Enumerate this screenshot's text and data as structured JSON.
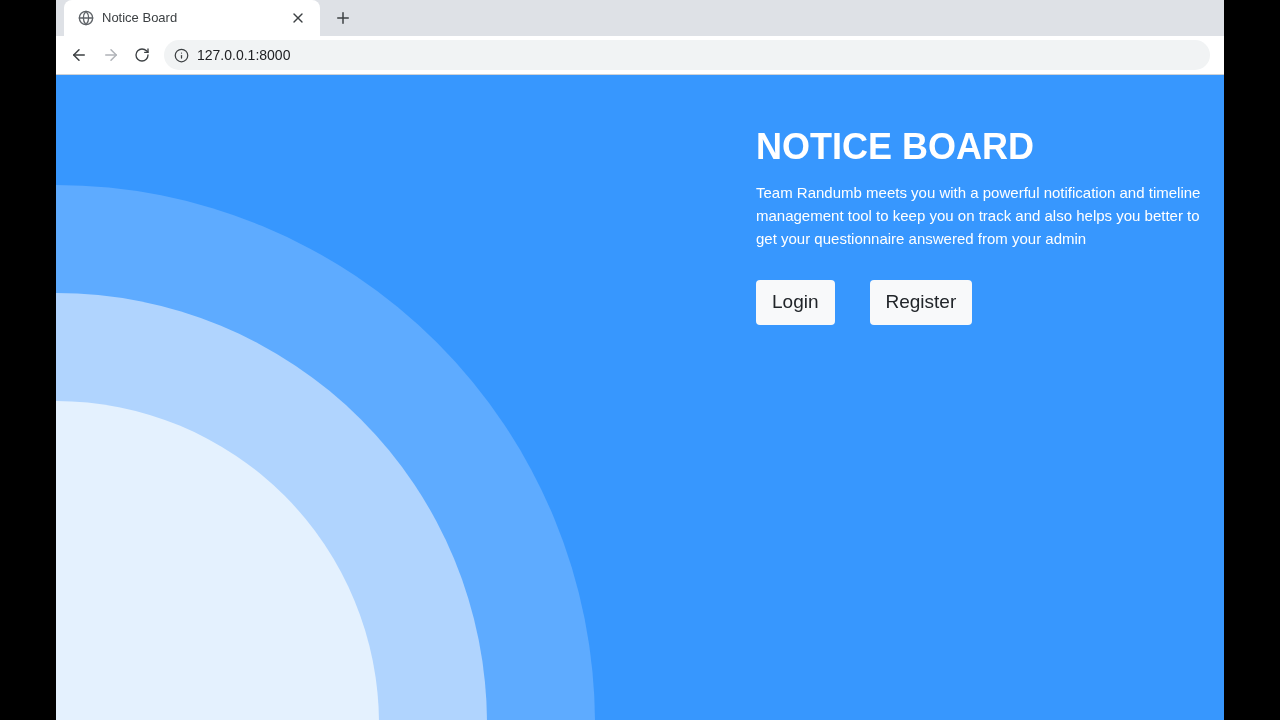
{
  "browser": {
    "tab": {
      "title": "Notice Board"
    },
    "address": "127.0.0.1:8000"
  },
  "hero": {
    "title": "NOTICE BOARD",
    "description": "Team Randumb meets you with a powerful notification and timeline management tool to keep you on track and also helps you better to get your questionnaire answered from your admin",
    "buttons": [
      "Login",
      "Register"
    ]
  }
}
